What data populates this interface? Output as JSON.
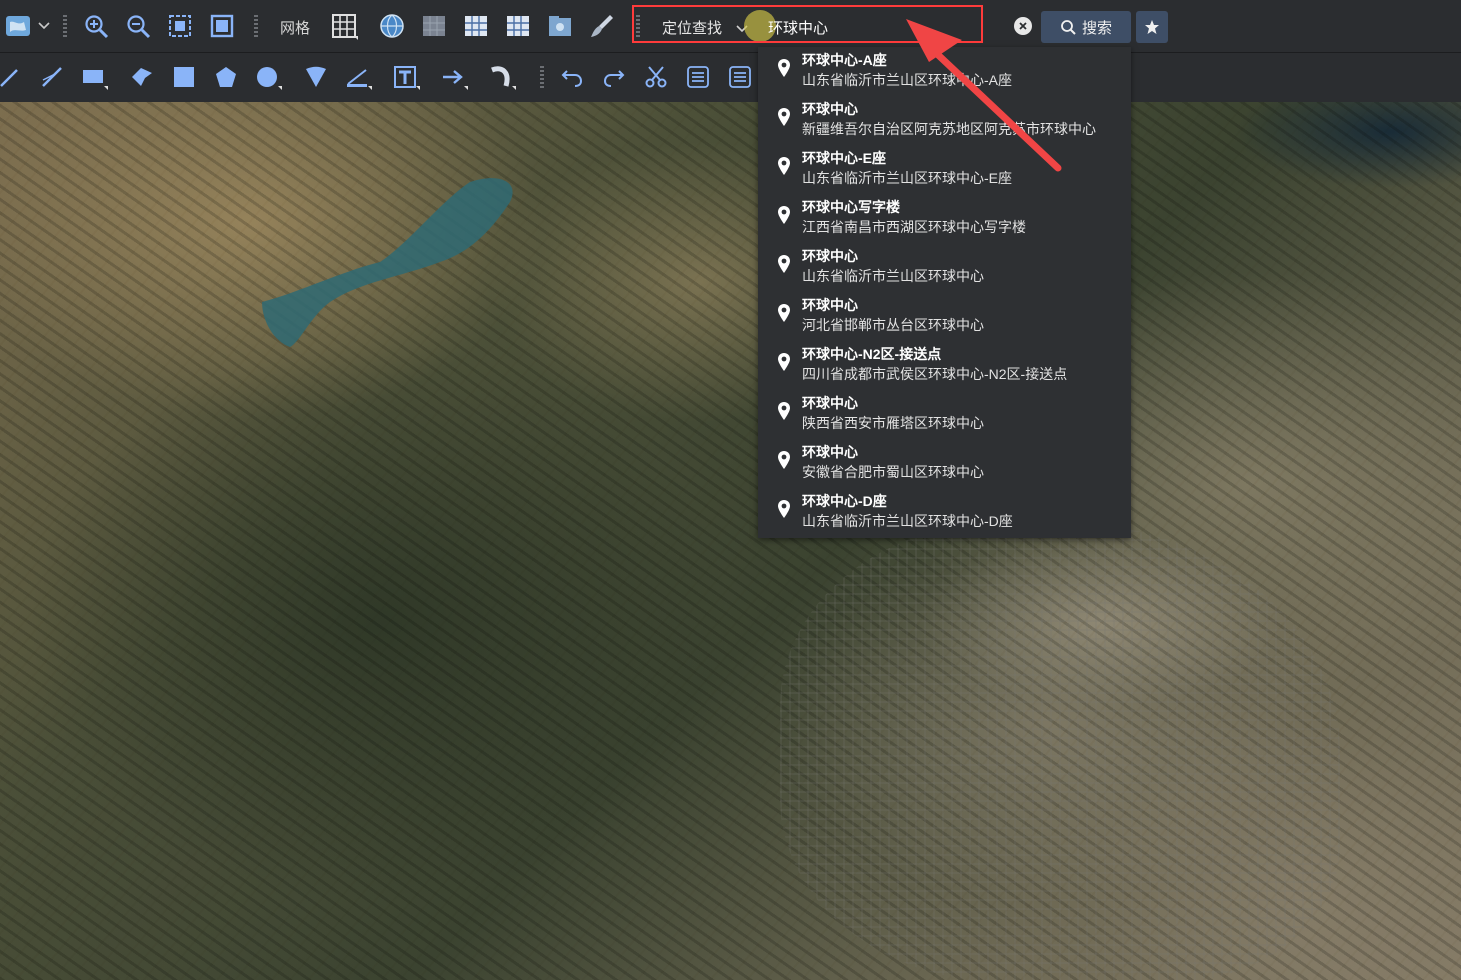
{
  "toolbar": {
    "grid_label": "网格",
    "icons": [
      "globe-icon",
      "zoom-in-icon",
      "zoom-out-icon",
      "zoom-extent-icon",
      "full-extent-icon",
      "grid-icon",
      "latlng-globe-icon",
      "km-grid-icon",
      "nm-grid-icon",
      "mgrs-grid-icon",
      "folder-icon",
      "brush-icon"
    ]
  },
  "draw_toolbar": {
    "icons": [
      "line-icon",
      "freehand-icon",
      "rectangle-icon",
      "arrow-shape-icon",
      "square-icon",
      "pentagon-icon",
      "circle-icon",
      "sector-icon",
      "measure-icon",
      "text-icon",
      "arrow-icon",
      "curve-icon",
      "undo-icon",
      "redo-icon",
      "cut-icon",
      "list-icon",
      "list2-icon"
    ]
  },
  "search": {
    "type_label": "定位查找",
    "query": "环球中心",
    "button_label": "搜索",
    "highlight_color": "#ff3b3b"
  },
  "results": [
    {
      "title": "环球中心-A座",
      "address": "山东省临沂市兰山区环球中心-A座"
    },
    {
      "title": "环球中心",
      "address": "新疆维吾尔自治区阿克苏地区阿克苏市环球中心"
    },
    {
      "title": "环球中心-E座",
      "address": "山东省临沂市兰山区环球中心-E座"
    },
    {
      "title": "环球中心写字楼",
      "address": "江西省南昌市西湖区环球中心写字楼"
    },
    {
      "title": "环球中心",
      "address": "山东省临沂市兰山区环球中心"
    },
    {
      "title": "环球中心",
      "address": "河北省邯郸市丛台区环球中心"
    },
    {
      "title": "环球中心-N2区-接送点",
      "address": "四川省成都市武侯区环球中心-N2区-接送点"
    },
    {
      "title": "环球中心",
      "address": "陕西省西安市雁塔区环球中心"
    },
    {
      "title": "环球中心",
      "address": "安徽省合肥市蜀山区环球中心"
    },
    {
      "title": "环球中心-D座",
      "address": "山东省临沂市兰山区环球中心-D座"
    }
  ]
}
